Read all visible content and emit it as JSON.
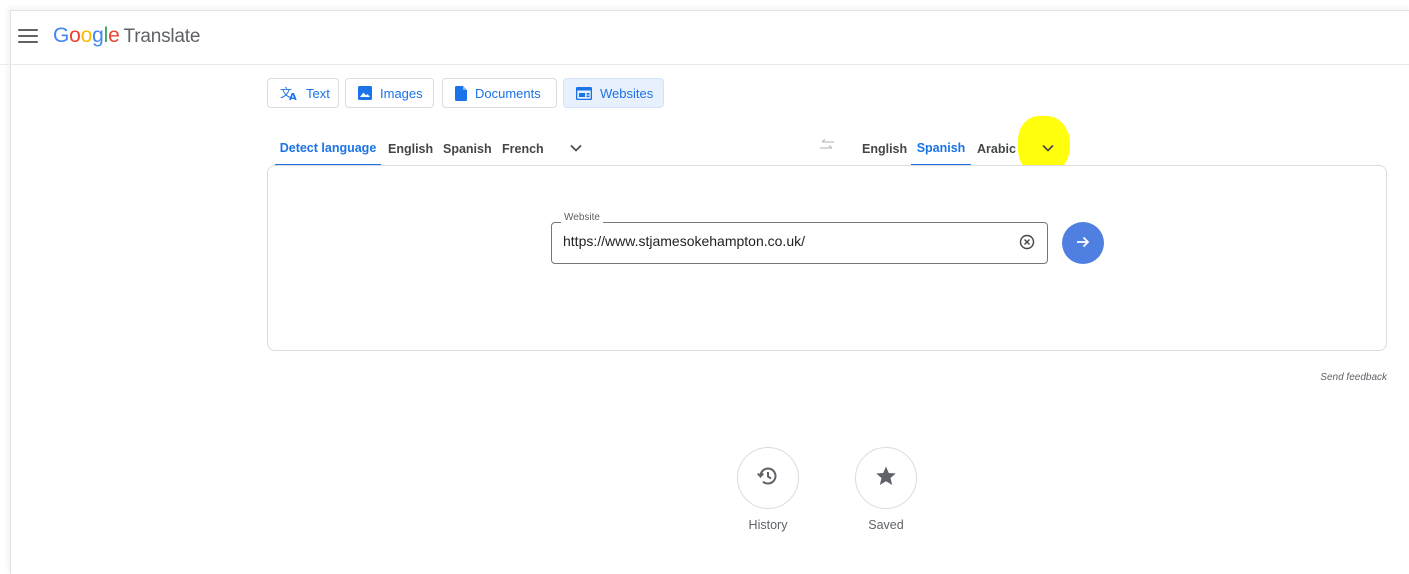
{
  "header": {
    "logo_letters": [
      "G",
      "o",
      "o",
      "g",
      "l",
      "e"
    ],
    "product_name": "Translate"
  },
  "modes": [
    {
      "label": "Text",
      "icon": "translate-icon",
      "active": false
    },
    {
      "label": "Images",
      "icon": "image-icon",
      "active": false
    },
    {
      "label": "Documents",
      "icon": "document-icon",
      "active": false
    },
    {
      "label": "Websites",
      "icon": "website-icon",
      "active": true
    }
  ],
  "source_languages": {
    "items": [
      "Detect language",
      "English",
      "Spanish",
      "French"
    ],
    "selected": "Detect language"
  },
  "target_languages": {
    "items": [
      "English",
      "Spanish",
      "Arabic"
    ],
    "selected": "Spanish"
  },
  "website_field": {
    "label": "Website",
    "value": "https://www.stjamesokehampton.co.uk/"
  },
  "feedback_label": "Send feedback",
  "bottom_actions": [
    {
      "label": "History",
      "icon": "history-icon"
    },
    {
      "label": "Saved",
      "icon": "star-icon"
    }
  ],
  "colors": {
    "accent": "#1a73e8",
    "go_button": "#4f7fe0",
    "highlight": "#ffff00"
  }
}
